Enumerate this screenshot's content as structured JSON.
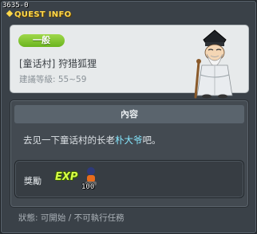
{
  "window": {
    "quest_id": "3635-0",
    "title": "QUEST INFO"
  },
  "info": {
    "type_badge": "一般",
    "quest_name": "[童话村] 狩猎狐狸",
    "level_requirement": "建議等級: 55~59",
    "npc_portrait": "bearded-elder-with-cane"
  },
  "content": {
    "header": "內容",
    "description_prefix": "去见一下童话村的长老",
    "description_npc": "朴大爷",
    "description_suffix": "吧。"
  },
  "reward": {
    "label": "獎勵",
    "exp_label": "EXP",
    "exp_amount": "100"
  },
  "status": {
    "text": "狀態: 可開始 / 不可執行任務"
  },
  "colors": {
    "title": "#ffd84a",
    "badge": "#7ec232",
    "npc_highlight": "#86e8ff",
    "exp": "#d7ff45"
  }
}
